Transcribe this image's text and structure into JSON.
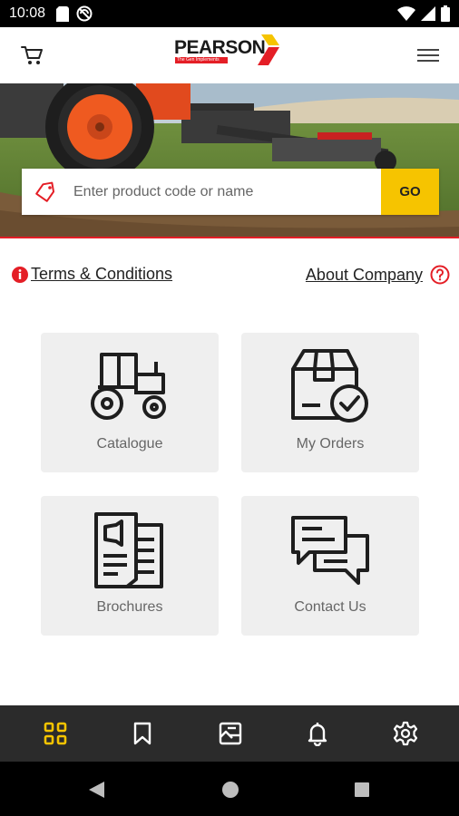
{
  "status_bar": {
    "time": "10:08",
    "icons": [
      "sd-card-icon",
      "no-disturb-icon",
      "wifi-icon",
      "signal-icon",
      "battery-icon"
    ]
  },
  "header": {
    "logo": {
      "name": "PEARSON",
      "tagline": "The Gen Implements"
    },
    "left_icon": "cart-icon",
    "right_icon": "hamburger-menu-icon"
  },
  "search": {
    "placeholder": "Enter product code or name",
    "value": "",
    "button_label": "GO",
    "icon": "tag-icon"
  },
  "links": {
    "terms_label": "Terms & Conditions",
    "about_label": "About Company"
  },
  "tiles": [
    {
      "label": "Catalogue",
      "icon": "tractor-icon"
    },
    {
      "label": "My Orders",
      "icon": "box-check-icon"
    },
    {
      "label": "Brochures",
      "icon": "brochure-icon"
    },
    {
      "label": "Contact Us",
      "icon": "chat-bubbles-icon"
    }
  ],
  "bottom_nav": {
    "items": [
      {
        "icon": "grid-icon",
        "active": true
      },
      {
        "icon": "bookmark-icon",
        "active": false
      },
      {
        "icon": "gallery-icon",
        "active": false
      },
      {
        "icon": "bell-icon",
        "active": false
      },
      {
        "icon": "gear-icon",
        "active": false
      }
    ]
  },
  "colors": {
    "accent": "#f6c400",
    "brand_red": "#e41e26",
    "nav_bg": "#2b2b2b",
    "tile_bg": "#efefef"
  }
}
